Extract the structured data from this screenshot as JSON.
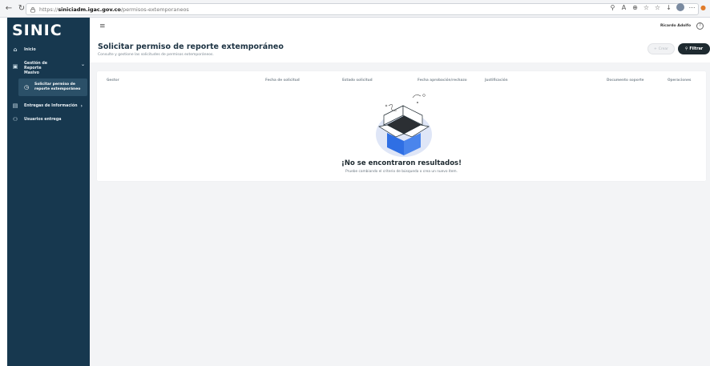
{
  "browser": {
    "url_prefix": "https://",
    "url_host": "siniciadm.igac.gov.co",
    "url_path": "/permisos-extemporaneos"
  },
  "sidebar": {
    "logo": "SINIC",
    "items": [
      {
        "label": "Inicio",
        "icon": "home-icon"
      },
      {
        "label": "Gestión de Reporte Masivo",
        "icon": "report-icon"
      },
      {
        "label": "Solicitar permiso de reporte extemporáneo",
        "icon": "clock-icon"
      },
      {
        "label": "Entregas de Información",
        "icon": "inbox-icon"
      },
      {
        "label": "Usuarios entrega",
        "icon": "users-icon"
      }
    ]
  },
  "topbar": {
    "user_name": "Ricardo Adolfo"
  },
  "page": {
    "title": "Solicitar permiso de reporte extemporáneo",
    "subtitle": "Consulte y gestione las solicitudes de permisos extemporáneos.",
    "btn_crear": "Crear",
    "btn_filtrar": "Filtrar"
  },
  "table": {
    "columns": [
      "Gestor",
      "Fecha de solicitud",
      "Estado solicitud",
      "Fecha aprobación/rechazo",
      "Justificación",
      "Documento soporte",
      "Operaciones"
    ]
  },
  "empty": {
    "title": "¡No se encontraron resultados!",
    "subtitle": "Pruebe cambiando el criterio de búsqueda o crea un nuevo ítem."
  },
  "colors": {
    "sidebar": "#17384f",
    "accent_dark": "#1e2a30",
    "box_blue": "#2f6fe4"
  }
}
